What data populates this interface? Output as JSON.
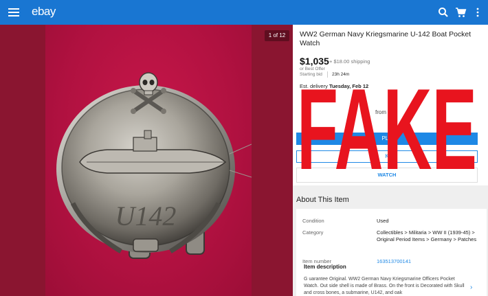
{
  "appbar": {
    "logo": "ebay",
    "icons": [
      "menu-icon",
      "search-icon",
      "cart-icon",
      "more-vert-icon"
    ],
    "color": "#1976d2"
  },
  "gallery": {
    "counter": "1 of 12",
    "engraving": "U142"
  },
  "overlay": {
    "text": "FAKE",
    "color": "#e8141e"
  },
  "item": {
    "title": "WW2 German Navy Kriegsmarine U-142 Boat Pocket Watch",
    "price": "$1,035",
    "shipping": "+ $18.00 shipping",
    "best_offer": "or Best Offer",
    "bid_label": "Starting bid",
    "bid_time": "23h 24m",
    "delivery_label": "Est. delivery ",
    "delivery_date": "Tuesday, Feb 12",
    "from_text": "from",
    "buy_button": "PLA",
    "second_button": "K",
    "watch_button": "WATCH"
  },
  "about": {
    "heading": "About This Item",
    "rows": [
      {
        "label": "Condition",
        "value": "Used"
      },
      {
        "label": "Category",
        "value": "Collectibles > Militaria > WW II (1939-45) > Original Period Items > Germany > Patches"
      },
      {
        "label": "Item number",
        "value": "163513700141"
      }
    ]
  },
  "description": {
    "heading": "Item description",
    "text": "G uarantee Original. WW2 German Navy Kriegsmarine Officers Pocket Watch. Out side shell is made of Brass. On the front is Decorated with Skull and cross bones, a submarine, U142, and oak"
  }
}
